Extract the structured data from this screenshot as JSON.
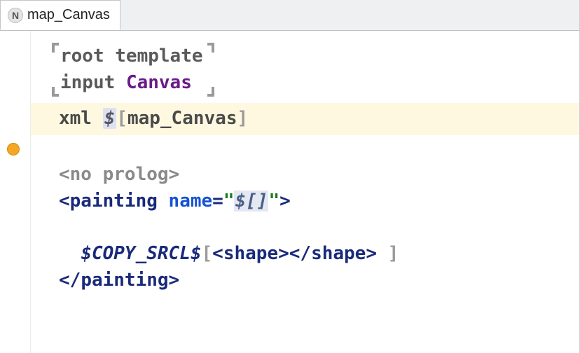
{
  "tab": {
    "badge": "N",
    "title": "map_Canvas"
  },
  "header": {
    "root_kw": "root",
    "template_kw": "template",
    "input_kw": "input",
    "input_type": "Canvas"
  },
  "xmlLine": {
    "xml_kw": "xml",
    "dollar": "$",
    "lbracket": "[",
    "map_name": "map_Canvas",
    "rbracket": "]"
  },
  "prolog": {
    "text": "<no prolog>"
  },
  "painting_open": {
    "lt": "<",
    "tag": "painting",
    "attr_name": "name",
    "eq": "=",
    "quote1": "\"",
    "placeholder": "$[]",
    "quote2": "\"",
    "gt": ">"
  },
  "copy_line": {
    "var": "$COPY_SRCL$",
    "lbracket": "[",
    "shape_open_lt": "<",
    "shape_open_name": "shape",
    "shape_open_gt": ">",
    "shape_close_lt": "</",
    "shape_close_name": "shape",
    "shape_close_gt": ">",
    "rbracket": "]"
  },
  "painting_close": {
    "lt": "</",
    "tag": "painting",
    "gt": ">"
  }
}
